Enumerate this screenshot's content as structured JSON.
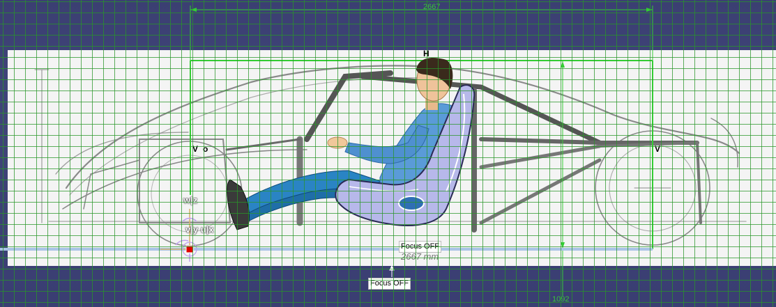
{
  "viewport": {
    "background": "#3b3f72",
    "grid_color": "#2e962e",
    "accent_green": "#39c339"
  },
  "dimensions": {
    "overall_length": "2667",
    "height_value": "1092",
    "sketch_length_note": "2667 mm"
  },
  "labels": {
    "h_point": "H",
    "v_left": "V",
    "v_right": "V",
    "origin_o": "o",
    "axis_w_z": "w|z",
    "axis_v_y_u_x": "v|y u|x"
  },
  "focus_indicators": {
    "primary": "Focus OFF",
    "secondary": "Focus OFF"
  },
  "icons": {
    "axis_marker": "compass-axis-icon",
    "driver": "driver-mannequin",
    "seat": "racing-seat"
  }
}
